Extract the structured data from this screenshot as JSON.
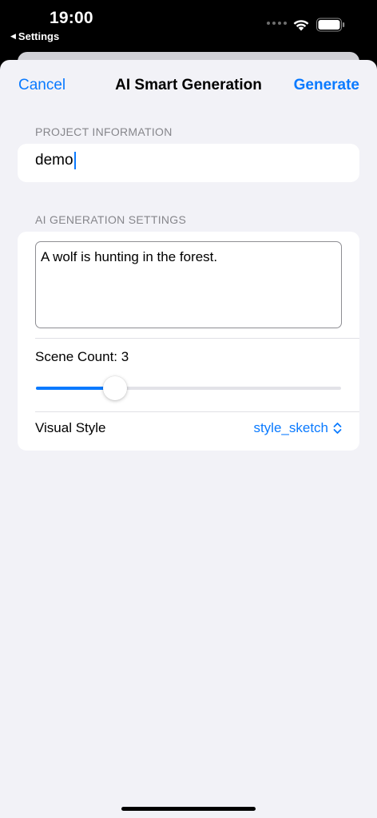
{
  "status_bar": {
    "time": "19:00",
    "back_app": "Settings"
  },
  "nav": {
    "cancel_label": "Cancel",
    "title": "AI Smart Generation",
    "generate_label": "Generate"
  },
  "project_info": {
    "header": "PROJECT INFORMATION",
    "name_value": "demo"
  },
  "ai_settings": {
    "header": "AI GENERATION SETTINGS",
    "prompt_value": "A wolf is hunting in the forest.",
    "scene_count_label": "Scene Count: 3",
    "scene_count_fraction": 0.24,
    "visual_style_label": "Visual Style",
    "visual_style_value": "style_sketch"
  },
  "colors": {
    "accent": "#0a7aff",
    "background": "#f2f2f7",
    "card": "#ffffff",
    "secondary_text": "#86868b"
  },
  "icons": {
    "back": "back-triangle-icon",
    "wifi": "wifi-icon",
    "battery": "battery-icon",
    "picker": "chevron-updown-icon"
  }
}
